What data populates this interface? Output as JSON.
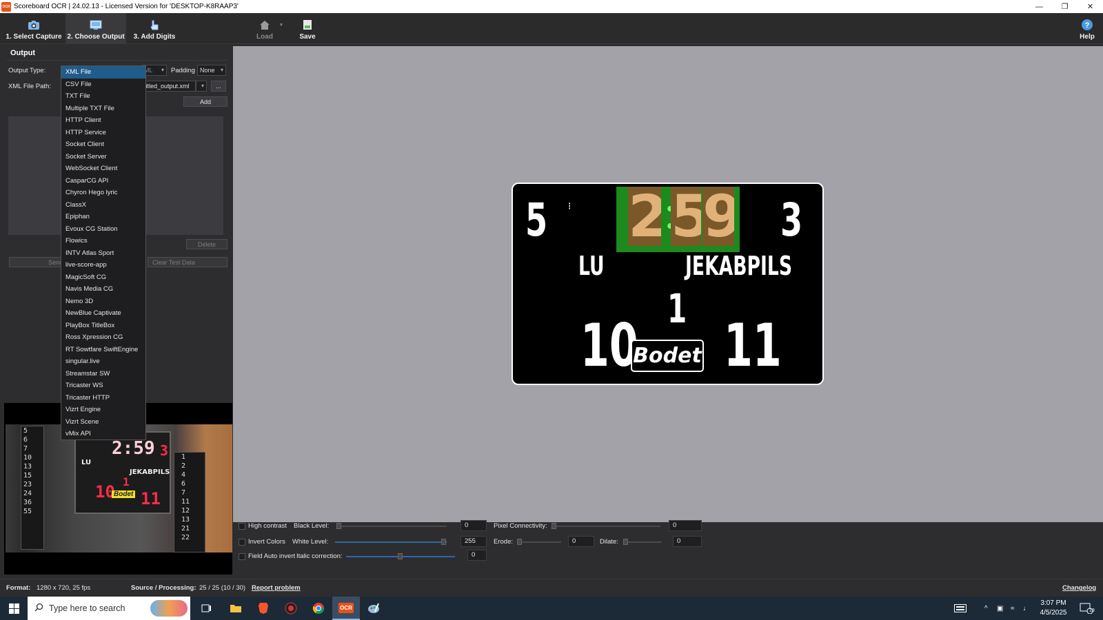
{
  "window": {
    "title": "Scoreboard OCR | 24.02.13 - Licensed Version for 'DESKTOP-K8RAAP3'",
    "logo_text": "OCR",
    "minimize_icon": "minimize-icon",
    "restore_icon": "restore-icon",
    "close_icon": "close-icon"
  },
  "toolbar": {
    "select_capture": "1. Select Capture",
    "choose_output": "2. Choose Output",
    "add_digits": "3. Add Digits",
    "load": "Load",
    "save": "Save",
    "help": "Help"
  },
  "output_panel": {
    "title": "Output",
    "output_type_label": "Output Type:",
    "output_type_value_fragment": "ML",
    "padding_label": "Padding",
    "padding_value": "None",
    "file_path_label": "XML File Path:",
    "file_path_value": "titled_output.xml",
    "browse_label": "...",
    "add_label": "Add",
    "delete_label": "Delete",
    "send_test_label": "Send T",
    "clear_test_label": "Clear Test Data"
  },
  "dropdown": {
    "selected_index": 0,
    "options": [
      "XML File",
      "CSV File",
      "TXT File",
      "Multiple TXT File",
      "HTTP Client",
      "HTTP Service",
      "Socket Client",
      "Socket Server",
      "WebSocket Client",
      "CasparCG API",
      "Chyron Hego lyric",
      "ClassX",
      "Epiphan",
      "Evoux CG Station",
      "Flowics",
      "INTV Atlas Sport",
      "live-score-app",
      "MagicSoft CG",
      "Navis Media CG",
      "Nemo 3D",
      "NewBlue Captivate",
      "PlayBox TitleBox",
      "Ross Xpression CG",
      "RT Sowtfare SwiftEngine",
      "singular.live",
      "Streamstar SW",
      "Tricaster WS",
      "Tricaster HTTP",
      "Vizrt Engine",
      "Vizrt Scene",
      "vMix API"
    ]
  },
  "preview": {
    "left_column": [
      "5",
      "6",
      "7",
      "10",
      "13",
      "15",
      "23",
      "24",
      "36",
      "55"
    ],
    "right_column": [
      "1",
      "2",
      "4",
      "6",
      "7",
      "11",
      "12",
      "13",
      "21",
      "22"
    ],
    "clock": "2:59",
    "period": "3",
    "team_left": "LU",
    "team_right": "JEKABPILS",
    "quarter": "1",
    "score_left": "10",
    "score_right": "11",
    "brand": "Bodet"
  },
  "scoreboard": {
    "left_number": "5",
    "right_number": "3",
    "clock_digits": [
      "2",
      "5",
      "9"
    ],
    "team_left": "LU",
    "team_right": "JEKABPILS",
    "quarter": "1",
    "score_left": "10",
    "score_right": "11",
    "brand": "Bodet"
  },
  "filters": {
    "high_contrast": "High contrast",
    "invert_colors": "Invert Colors",
    "field_auto_invert": "Field Auto invert",
    "black_level_label": "Black Level:",
    "black_level_value": "0",
    "white_level_label": "White Level:",
    "white_level_value": "255",
    "italic_label": "Italic correction:",
    "italic_value": "0",
    "pixel_conn_label": "Pixel Connectivity:",
    "pixel_conn_value": "0",
    "erode_label": "Erode:",
    "erode_value": "0",
    "dilate_label": "Dilate:",
    "dilate_value": "0",
    "white_level_fraction": 1.0,
    "italic_fraction": 0.5
  },
  "status": {
    "format_label": "Format:",
    "format_value": "1280 x 720, 25 fps",
    "source_label": "Source / Processing:",
    "source_value": "25 / 25 (10 / 30)",
    "report_link": "Report problem",
    "changelog_link": "Changelog"
  },
  "taskbar": {
    "search_placeholder": "Type here to search",
    "time": "3:07 PM",
    "date": "4/5/2025",
    "notification_count": "19",
    "ocr_app_label": "OCR"
  },
  "colors": {
    "canvas_bg": "#a3a2a8",
    "clock_green": "#1d8a1d",
    "clock_brown": "#7a5828",
    "selection_blue": "#1f5c8a",
    "ocr_orange": "#e8521a"
  }
}
